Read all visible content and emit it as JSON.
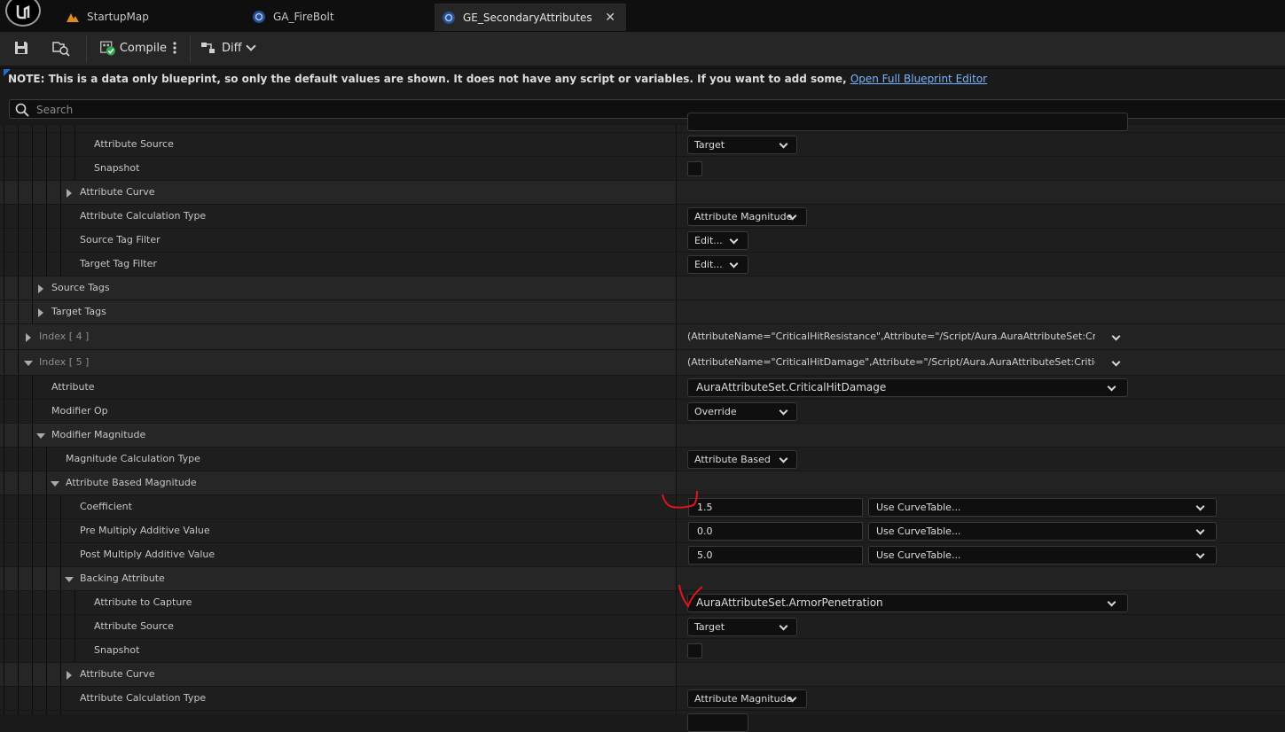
{
  "tabs": [
    {
      "label": "StartupMap"
    },
    {
      "label": "GA_FireBolt"
    },
    {
      "label": "GE_SecondaryAttributes"
    }
  ],
  "toolbar": {
    "compile_label": "Compile",
    "diff_label": "Diff"
  },
  "note": {
    "text": "NOTE: This is a data only blueprint, so only the default values are shown.  It does not have any script or variables.  If you want to add some,",
    "link": "Open Full Blueprint Editor"
  },
  "search": {
    "placeholder": "Search"
  },
  "rows": [
    {
      "name": "Attribute Source",
      "value": "Target"
    },
    {
      "name": "Snapshot"
    },
    {
      "name": "Attribute Curve"
    },
    {
      "name": "Attribute Calculation Type",
      "value": "Attribute Magnitude"
    },
    {
      "name": "Source Tag Filter",
      "value": "Edit..."
    },
    {
      "name": "Target Tag Filter",
      "value": "Edit..."
    },
    {
      "name": "Source Tags"
    },
    {
      "name": "Target Tags"
    },
    {
      "name": "Index [ 4 ]",
      "value": "(AttributeName=\"CriticalHitResistance\",Attribute=\"/Script/Aura.AuraAttributeSet:CriticalHit"
    },
    {
      "name": "Index [ 5 ]",
      "value": "(AttributeName=\"CriticalHitDamage\",Attribute=\"/Script/Aura.AuraAttributeSet:CriticalHitDar"
    },
    {
      "name": "Attribute",
      "value": "AuraAttributeSet.CriticalHitDamage"
    },
    {
      "name": "Modifier Op",
      "value": "Override"
    },
    {
      "name": "Modifier Magnitude"
    },
    {
      "name": "Magnitude Calculation Type",
      "value": "Attribute Based"
    },
    {
      "name": "Attribute Based Magnitude"
    },
    {
      "name": "Coefficient",
      "value": "1.5",
      "curve": "Use CurveTable..."
    },
    {
      "name": "Pre Multiply Additive Value",
      "value": "0.0",
      "curve": "Use CurveTable..."
    },
    {
      "name": "Post Multiply Additive Value",
      "value": "5.0",
      "curve": "Use CurveTable..."
    },
    {
      "name": "Backing Attribute"
    },
    {
      "name": "Attribute to Capture",
      "value": "AuraAttributeSet.ArmorPenetration"
    },
    {
      "name": "Attribute Source",
      "value": "Target"
    },
    {
      "name": "Snapshot"
    },
    {
      "name": "Attribute Curve"
    },
    {
      "name": "Attribute Calculation Type",
      "value": "Attribute Magnitude"
    }
  ]
}
